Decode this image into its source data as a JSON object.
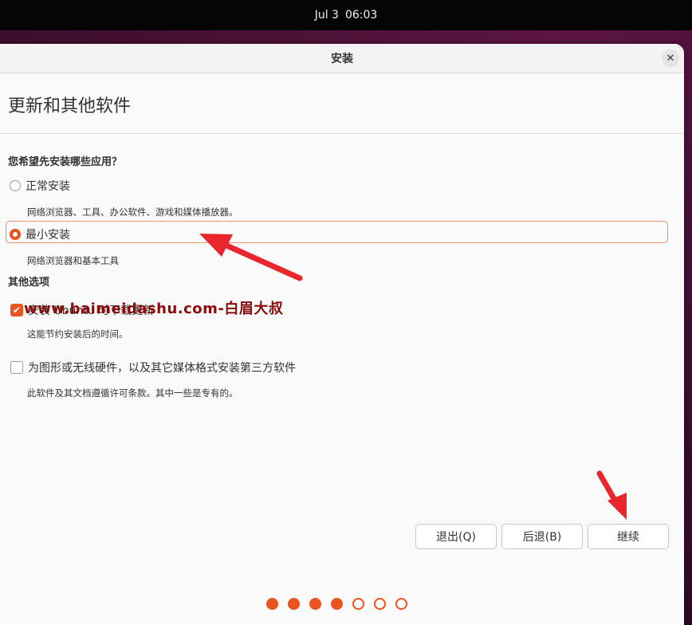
{
  "topbar": {
    "date": "Jul 3",
    "time": "06:03"
  },
  "window": {
    "title": "安装",
    "close_symbol": "✕"
  },
  "page": {
    "title": "更新和其他软件"
  },
  "install_type": {
    "question": "您希望先安装哪些应用？",
    "options": [
      {
        "label": "正常安装",
        "description": "网络浏览器、工具、办公软件、游戏和媒体播放器。",
        "selected": false
      },
      {
        "label": "最小安装",
        "description": "网络浏览器和基本工具",
        "selected": true
      }
    ]
  },
  "other_options": {
    "title": "其他选项",
    "items": [
      {
        "label": "安装 Ubuntu 时下载更新",
        "description": "这能节约安装后的时间。",
        "checked": true
      },
      {
        "label": "为图形或无线硬件，以及其它媒体格式安装第三方软件",
        "description": "此软件及其文档遵循许可条款。其中一些是专有的。",
        "checked": false
      }
    ]
  },
  "watermark": "www.baimeidashu.com-白眉大叔",
  "buttons": {
    "quit": "退出(Q)",
    "back": "后退(B)",
    "continue": "继续"
  },
  "progress": {
    "total_steps": 7,
    "completed_steps": 4
  },
  "colors": {
    "accent": "#e95420",
    "annotation_arrow": "#e8262b",
    "watermark": "#8b0a0a"
  }
}
